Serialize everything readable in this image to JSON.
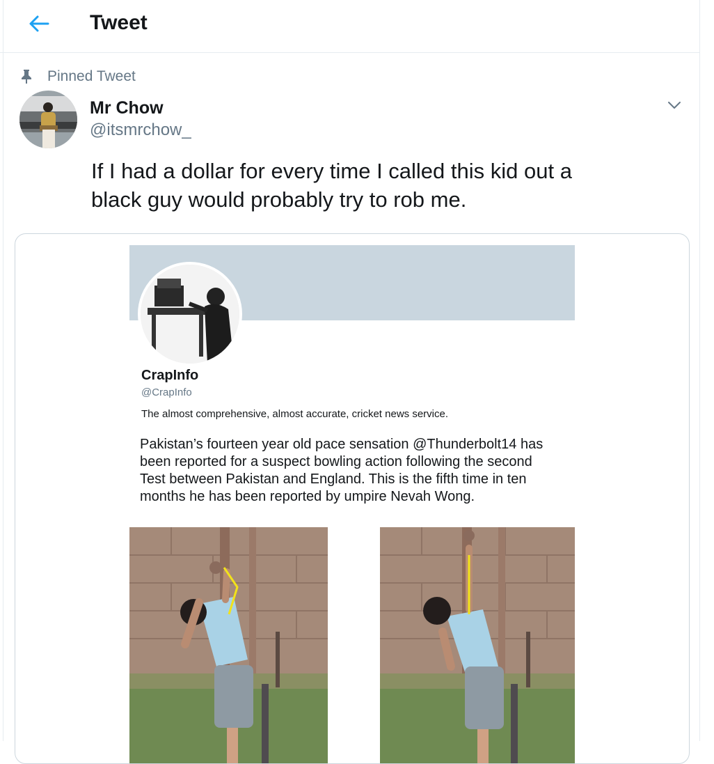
{
  "header": {
    "title": "Tweet"
  },
  "pinned": {
    "label": "Pinned Tweet"
  },
  "author": {
    "name": "Mr Chow",
    "handle": "@itsmrchow_"
  },
  "tweet": {
    "text": "If I had a dollar for every time I called this kid out a\nblack guy would probably try to rob me."
  },
  "embedded": {
    "name": "CrapInfo",
    "handle": "@CrapInfo",
    "bio": "The almost comprehensive, almost accurate, cricket news service.",
    "text": "Pakistan’s fourteen year old pace sensation @Thunderbolt14 has\nbeen reported for a suspect bowling action following the second\nTest between Pakistan and England. This is the fifth time in ten\nmonths he has been reported by umpire Nevah Wong."
  },
  "colors": {
    "accent": "#1da1f2",
    "secondary_text": "#657786",
    "border": "#e6ecf0",
    "banner": "#c9d6df",
    "annotation": "#f2e21a"
  },
  "icons": {
    "back": "arrow-left-icon",
    "pin": "pin-icon",
    "caret": "chevron-down-icon"
  }
}
